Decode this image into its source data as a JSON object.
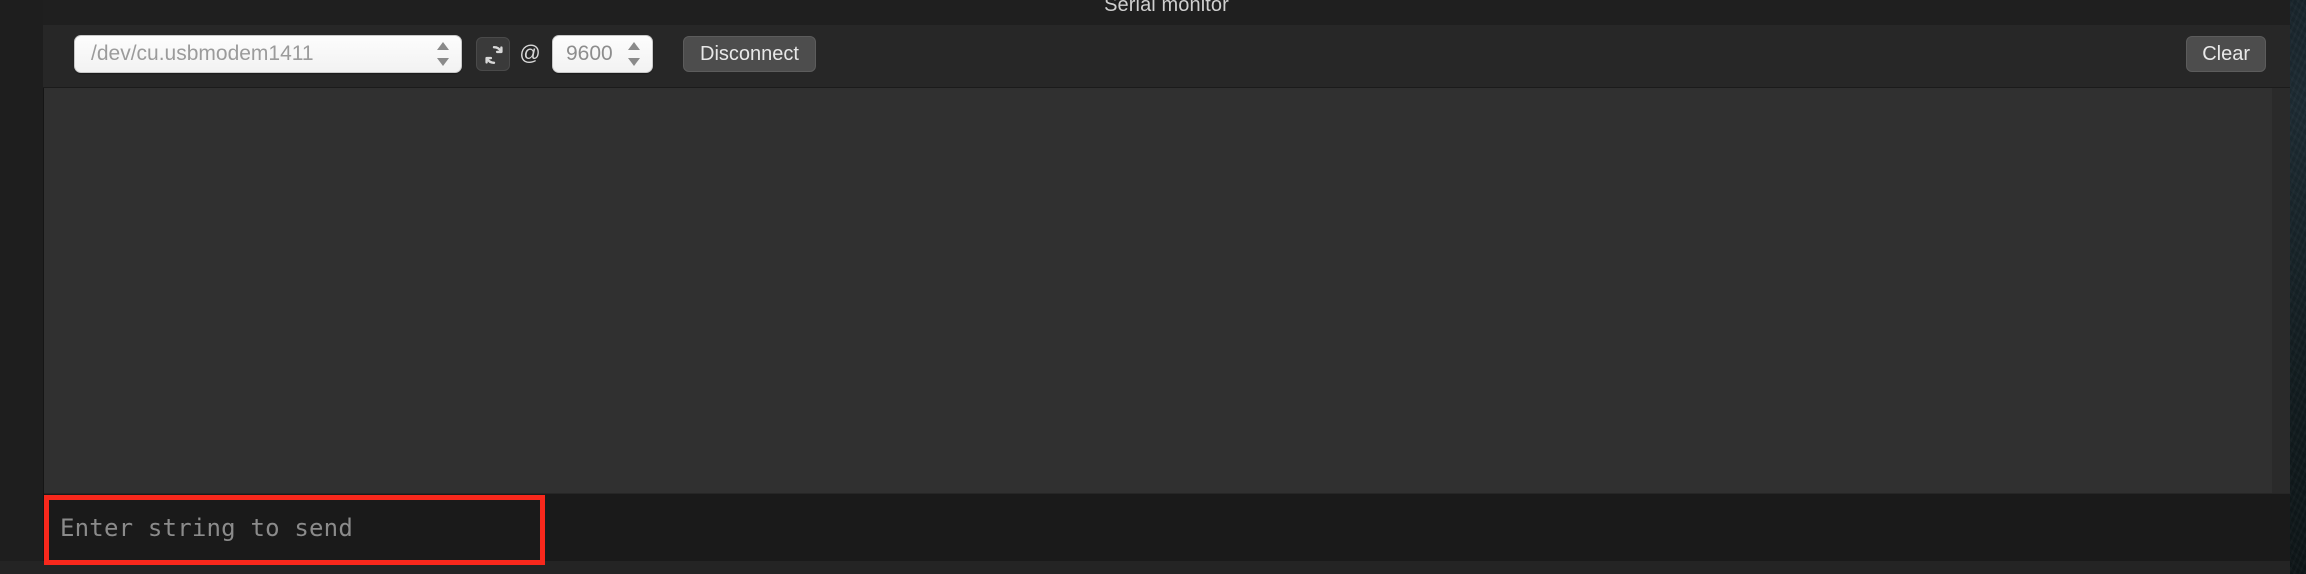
{
  "window": {
    "panel_title": "Serial monitor"
  },
  "toolbar": {
    "port_select": {
      "value": "/dev/cu.usbmodem1411",
      "options": [
        "/dev/cu.usbmodem1411"
      ]
    },
    "refresh_icon": "refresh-icon",
    "at_symbol": "@",
    "baud_select": {
      "value": "9600",
      "options": [
        "9600"
      ]
    },
    "connection_button_label": "Disconnect",
    "clear_button_label": "Clear"
  },
  "console": {
    "text": "",
    "scrollbar": "vertical-scrollbar"
  },
  "send_bar": {
    "value": "",
    "placeholder": "Enter string to send"
  },
  "annotation": {
    "target": "send-input",
    "color": "#f8281c"
  }
}
